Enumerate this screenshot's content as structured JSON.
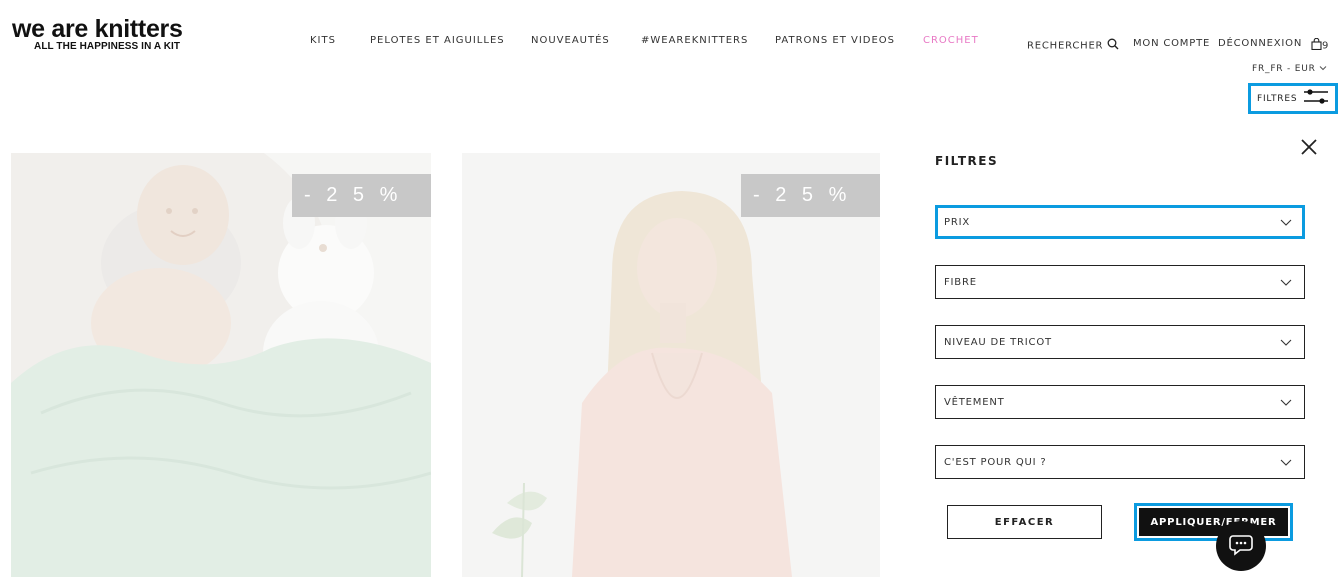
{
  "brand": {
    "name": "we are knitters",
    "tagline": "ALL THE HAPPINESS IN A KIT"
  },
  "nav": {
    "items": [
      {
        "label": "KITS",
        "highlight": false
      },
      {
        "label": "PELOTES ET AIGUILLES",
        "highlight": false
      },
      {
        "label": "NOUVEAUTÉS",
        "highlight": false
      },
      {
        "label": "#WEAREKNITTERS",
        "highlight": false
      },
      {
        "label": "PATRONS ET VIDEOS",
        "highlight": false
      },
      {
        "label": "CROCHET",
        "highlight": true
      }
    ],
    "highlight_color": "#e879c5"
  },
  "header_utils": {
    "search_label": "RECHERCHER",
    "account_label": "MON COMPTE",
    "logout_label": "DÉCONNEXION",
    "cart_count": "9",
    "locale_label": "FR_FR - EUR"
  },
  "filter_toggle": {
    "label": "FILTRES"
  },
  "products": [
    {
      "badge": "- 2 5 %",
      "image": "baby-with-green-knit-blanket"
    },
    {
      "badge": "- 2 5 %",
      "image": "woman-in-pink-v-back-sweater"
    }
  ],
  "filter_panel": {
    "title": "FILTRES",
    "selects": [
      {
        "label": "PRIX",
        "active": true
      },
      {
        "label": "FIBRE",
        "active": false
      },
      {
        "label": "NIVEAU DE TRICOT",
        "active": false
      },
      {
        "label": "VÊTEMENT",
        "active": false
      },
      {
        "label": "C'EST POUR QUI ?",
        "active": false
      }
    ],
    "clear_label": "EFFACER",
    "apply_label": "APPLIQUER/FERMER"
  },
  "colors": {
    "focus_outline": "#0b9be0",
    "badge_bg": "#c8c8c8",
    "primary_button": "#111111"
  }
}
